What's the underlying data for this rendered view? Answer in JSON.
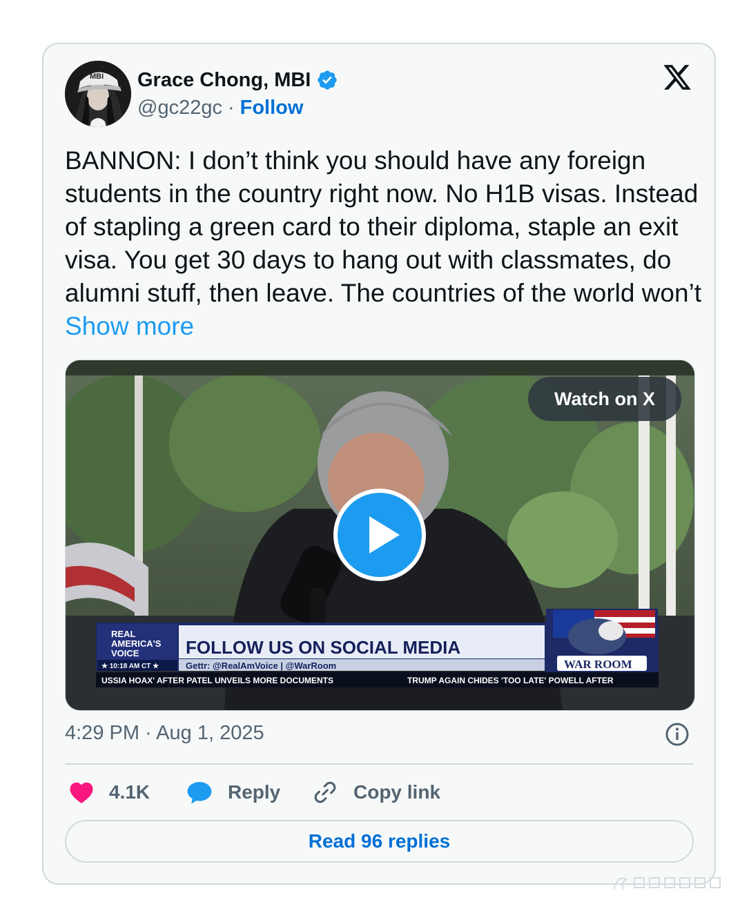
{
  "author": {
    "name": "Grace Chong, MBI",
    "handle": "@gc22gc",
    "separator": "·",
    "follow_label": "Follow",
    "avatar_cap_text": "MBI"
  },
  "tweet": {
    "text": "BANNON: I don’t think you should have any foreign students in the country right now. No H1B visas. Instead of stapling a green card to their diploma, staple an exit visa. You get 30 days to hang out with classmates, do alumni stuff, then leave. The countries of the world won’t ",
    "show_more_label": "Show more"
  },
  "media": {
    "watch_label": "Watch on X",
    "broadcast": {
      "network_line1": "REAL",
      "network_line2": "AMERICA'S",
      "network_line3": "VOICE",
      "time": "★ 10:18 AM CT ★",
      "headline": "FOLLOW US ON SOCIAL MEDIA",
      "subline": "Gettr: @RealAmVoice | @WarRoom",
      "show_logo": "WAR ROOM",
      "ticker_left": "USSIA HOAX' AFTER PATEL UNVEILS MORE DOCUMENTS",
      "ticker_right": "TRUMP AGAIN CHIDES 'TOO LATE' POWELL AFTER"
    }
  },
  "meta": {
    "timestamp": "4:29 PM · Aug 1, 2025"
  },
  "actions": {
    "likes": "4.1K",
    "reply_label": "Reply",
    "copy_label": "Copy link",
    "read_replies_label": "Read 96 replies"
  },
  "colors": {
    "accent": "#1d9bf0",
    "link": "#006fd6",
    "like": "#f91880",
    "text": "#0f1419",
    "muted": "#536471",
    "border": "#cfd9de",
    "card_bg": "#f7f9f9"
  },
  "icons": [
    "verified-badge-icon",
    "x-logo-icon",
    "play-icon",
    "info-icon",
    "heart-icon",
    "reply-bubble-icon",
    "link-icon"
  ]
}
